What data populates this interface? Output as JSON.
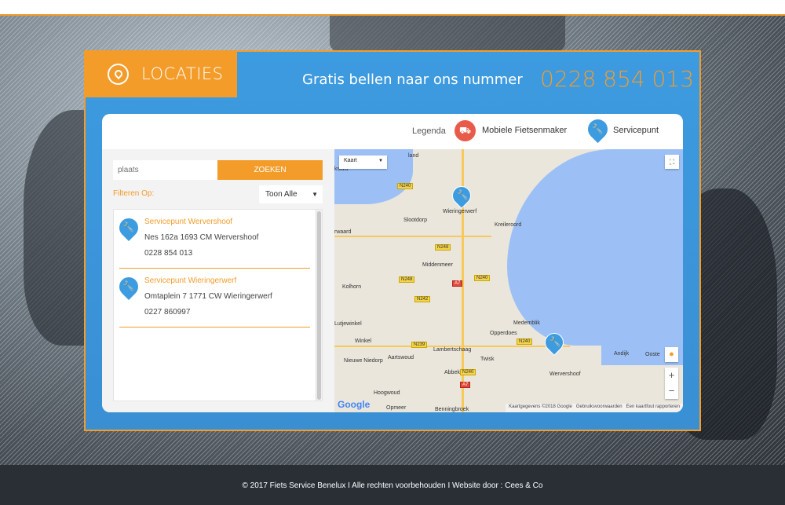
{
  "header": {
    "locations_title": "LOCATIES",
    "call_text": "Gratis bellen naar ons nummer",
    "phone_number": "0228 854 013"
  },
  "legend": {
    "label": "Legenda",
    "mobile_label": "Mobiele Fietsenmaker",
    "service_label": "Servicepunt"
  },
  "search": {
    "placeholder": "plaats",
    "button_label": "ZOEKEN",
    "filter_label": "Filteren Op:",
    "filter_selected": "Toon Alle"
  },
  "results": [
    {
      "name": "Servicepunt Wervershoof",
      "address": "Nes 162a 1693 CM Wervershoof",
      "phone": "0228 854 013"
    },
    {
      "name": "Servicepunt Wieringerwerf",
      "address": "Omtaplein 7 1771 CW Wieringerwerf",
      "phone": "0227 860997"
    }
  ],
  "map": {
    "type_label": "Kaart",
    "places": [
      "Wieringerwerf",
      "Slootdorp",
      "Kreileroord",
      "Middenmeer",
      "Kolhorn",
      "Medemblik",
      "Opperdoes",
      "Winkel",
      "Lambertschaag",
      "Aartswoud",
      "Twisk",
      "Abbekerk",
      "Nieuwe Niedorp",
      "Wervershoof",
      "Andijk",
      "Hoogwoud",
      "Opmeer",
      "Benningbroek",
      "Lutjewinkel",
      "rwaard",
      "ksluis",
      "land",
      "Ooste"
    ],
    "roads": [
      "N240",
      "N248",
      "N248",
      "N240",
      "A7",
      "N242",
      "N239",
      "N240",
      "A7",
      "N240"
    ],
    "google_label": "Google",
    "attribution": [
      "Kaartgegevens ©2018 Google",
      "Gebruiksvoorwaarden",
      "Een kaartfout rapporteren"
    ],
    "zoom_in": "+",
    "zoom_out": "−"
  },
  "footer": {
    "text": "© 2017 Fiets Service Benelux I Alle rechten voorbehouden I Website door : Cees & Co"
  },
  "colors": {
    "accent": "#f39c2a",
    "brand_blue": "#3d9be0",
    "mobile_red": "#e85b4a",
    "footer_bg": "#2a2f36"
  },
  "icons": {
    "locations": "location-pin-icon",
    "mobile": "truck-icon",
    "service": "wrench-icon",
    "fullscreen": "fullscreen-icon",
    "pegman": "pegman-icon"
  }
}
